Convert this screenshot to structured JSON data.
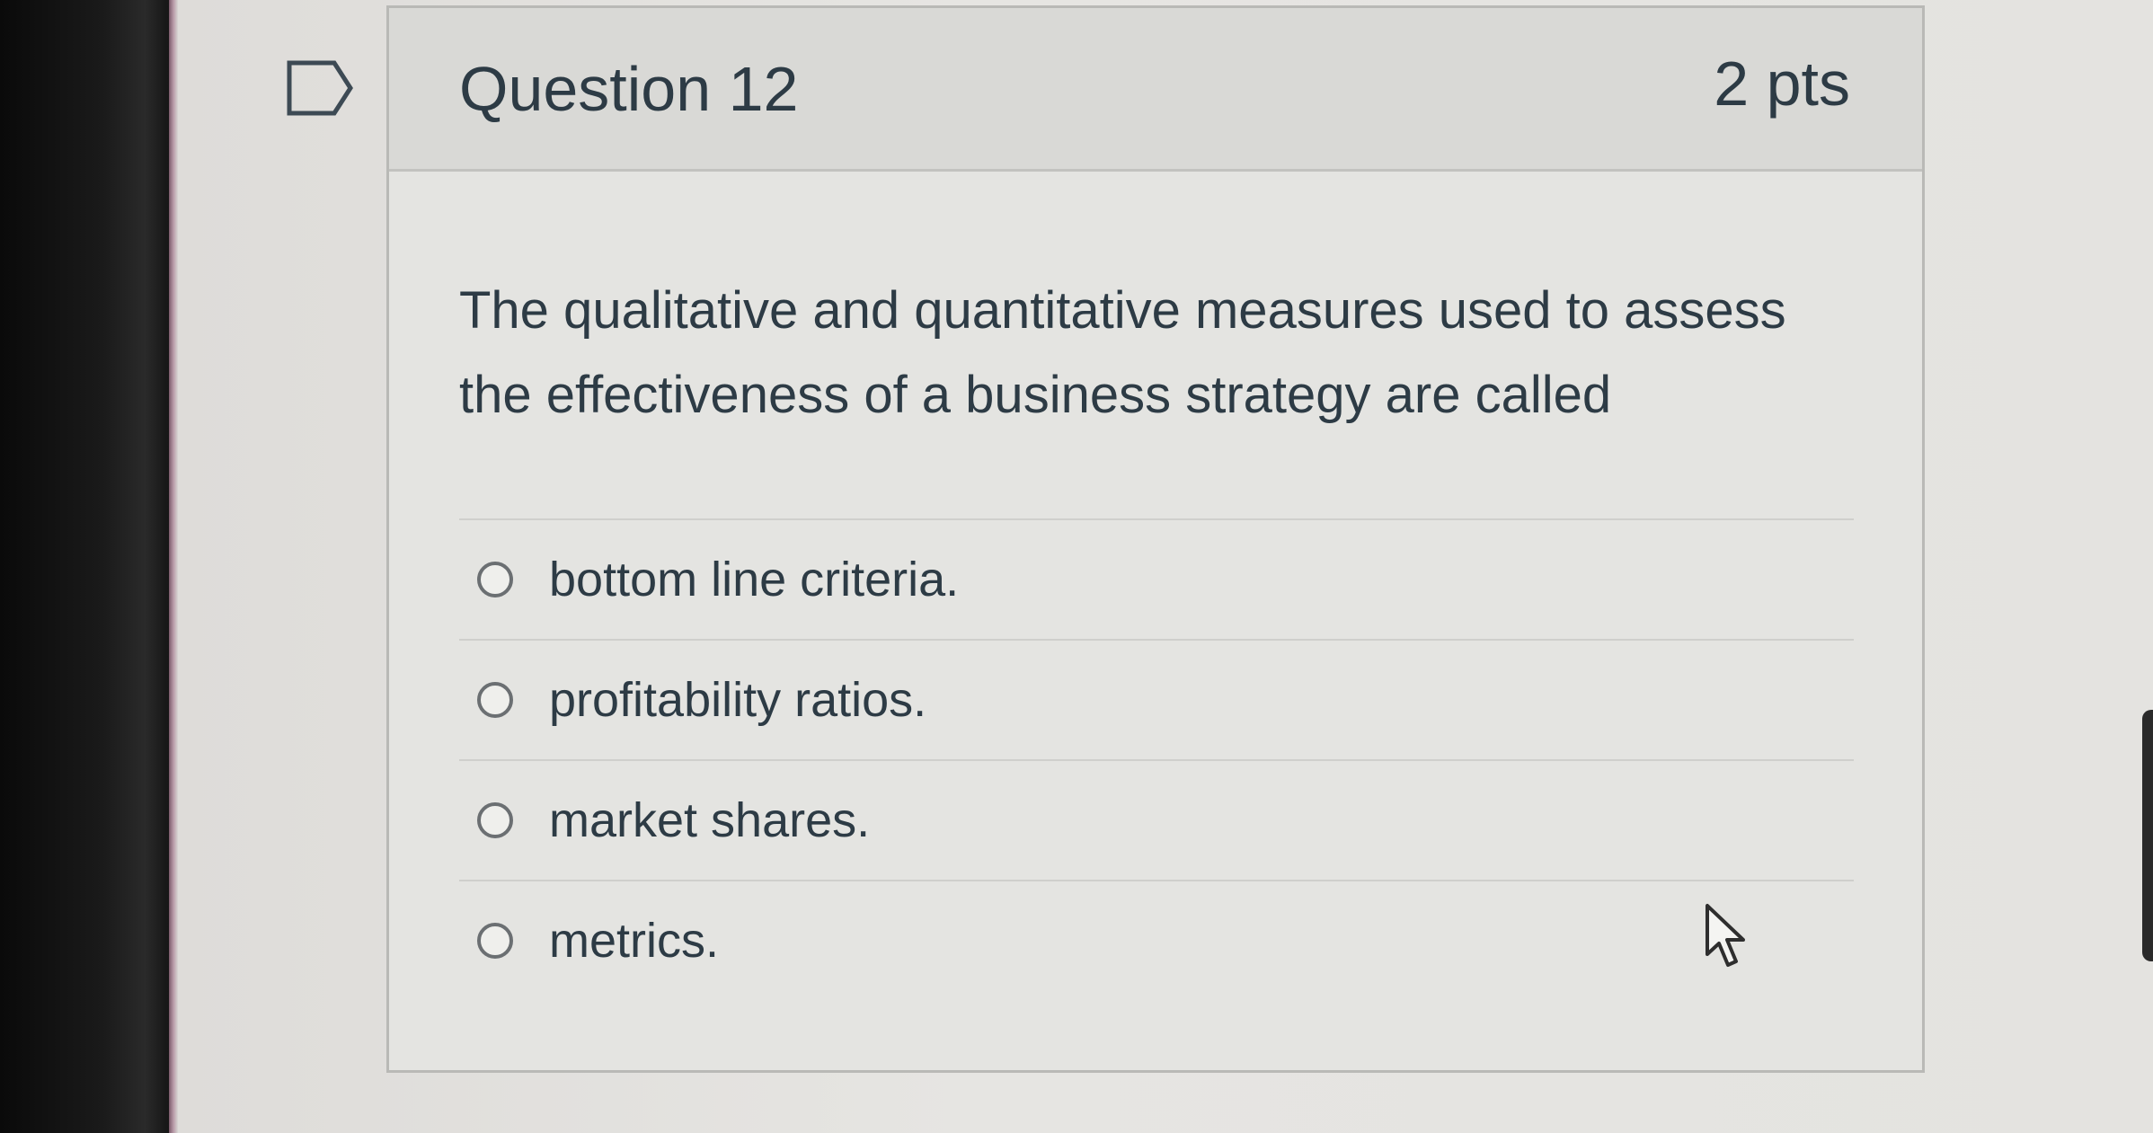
{
  "question": {
    "title": "Question 12",
    "points": "2 pts",
    "text": "The qualitative and quantitative measures used to assess the effectiveness of a business strategy are called"
  },
  "answers": [
    {
      "label": "bottom line criteria.",
      "selected": false
    },
    {
      "label": "profitability ratios.",
      "selected": false
    },
    {
      "label": "market shares.",
      "selected": false
    },
    {
      "label": "metrics.",
      "selected": false
    }
  ],
  "icons": {
    "flag": "bookmark-flag-icon",
    "cursor": "mouse-pointer-icon"
  },
  "colors": {
    "text": "#2d3b45",
    "header_bg": "#d9d9d6",
    "card_bg": "#e4e4e1",
    "border": "#b9b9b6"
  }
}
